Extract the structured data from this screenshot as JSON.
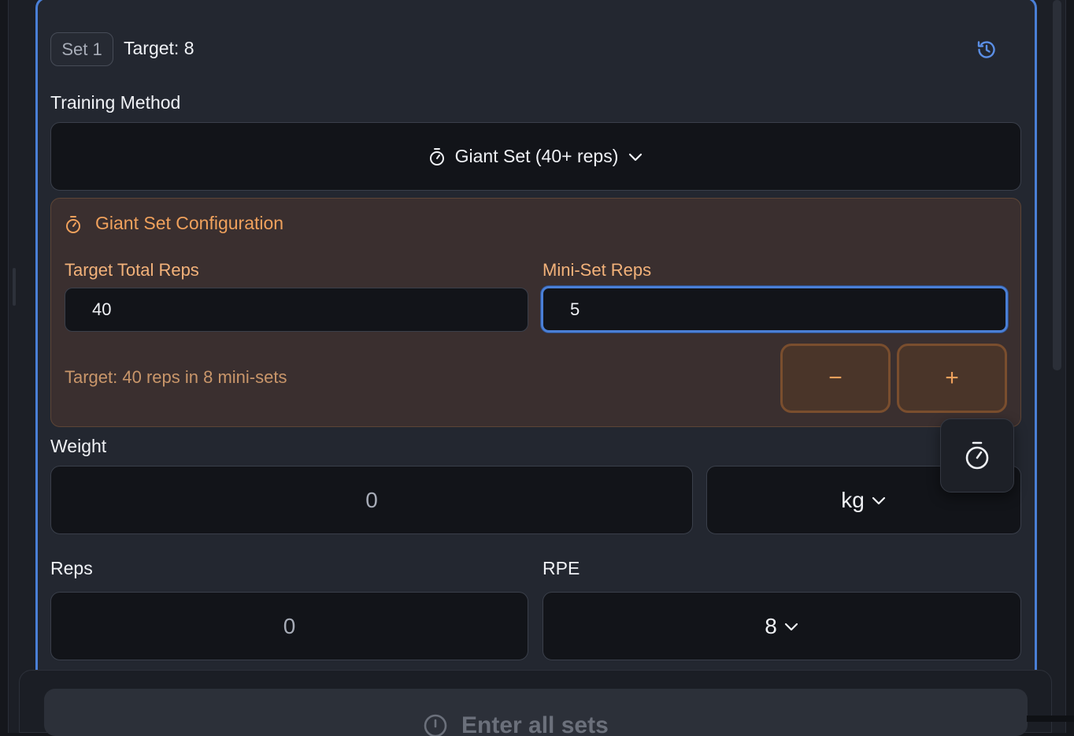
{
  "set": {
    "badge": "Set 1",
    "target": "Target: 8"
  },
  "training_method": {
    "label": "Training Method",
    "selected": "Giant Set (40+ reps)"
  },
  "giant_set": {
    "title": "Giant Set Configuration",
    "target_total_label": "Target Total Reps",
    "target_total_value": "40",
    "mini_set_label": "Mini-Set Reps",
    "mini_set_value": "5",
    "summary": "Target: 40 reps in 8 mini-sets",
    "minus": "−",
    "plus": "+"
  },
  "weight": {
    "label": "Weight",
    "value": "0",
    "unit": "kg"
  },
  "reps": {
    "label": "Reps",
    "value": "0"
  },
  "rpe": {
    "label": "RPE",
    "value": "8"
  },
  "bottom": {
    "action_label": "Enter all sets"
  },
  "icons": {
    "history": "history-icon",
    "stopwatch": "stopwatch-icon",
    "chevron": "chevron-down-icon"
  },
  "colors": {
    "accent_blue": "#4a7fd6",
    "accent_orange": "#f0a15c",
    "card_bg": "#232730",
    "input_bg": "#121419",
    "config_bg": "#3a2f2f"
  }
}
